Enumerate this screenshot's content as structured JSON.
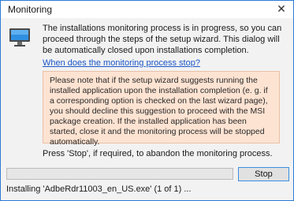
{
  "window": {
    "title": "Monitoring",
    "close_glyph": "✕"
  },
  "icon": "monitor-icon",
  "message": "The installations monitoring process is in progress, so you can proceed through the steps of the setup wizard. This dialog will be automatically closed upon installations completion.",
  "link_text": "When does the monitoring process stop?",
  "note": "Please note that if the setup wizard suggests running the installed application upon the installation completion (e. g. if a corresponding option is checked on the last wizard page), you should decline this suggestion to proceed with the MSI package creation. If the installed application has been started, close it and the monitoring process will be stopped automatically.",
  "hint": "Press 'Stop', if required, to abandon the monitoring process.",
  "progress": {
    "fraction": 0.0
  },
  "buttons": {
    "stop_label": "Stop"
  },
  "status_text": "Installing 'AdbeRdr11003_en_US.exe' (1 of 1) ...",
  "colors": {
    "accent": "#2b7bd6",
    "link": "#1a56c8",
    "note_bg": "#fde3d2"
  }
}
